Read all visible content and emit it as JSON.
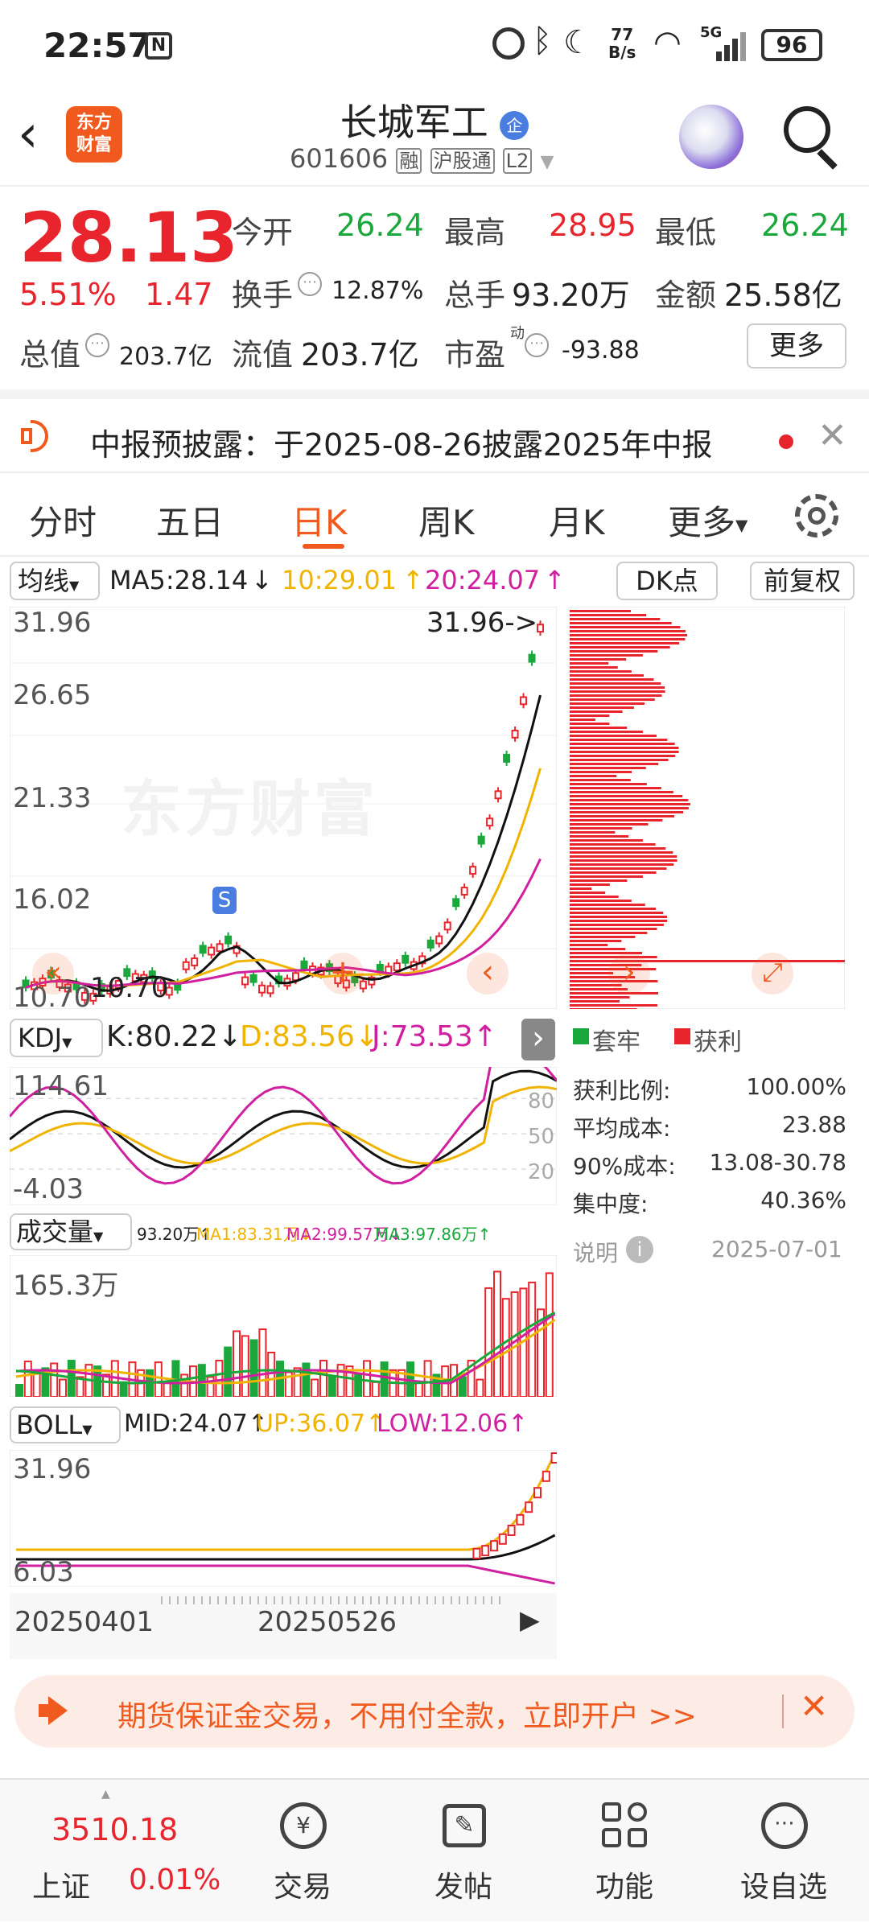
{
  "status": {
    "time": "22:57",
    "net_speed_top": "77",
    "net_speed_unit": "B/s",
    "signal": "5G",
    "battery": "96"
  },
  "header": {
    "logo_line1": "东方",
    "logo_line2": "财富",
    "title": "长城军工",
    "badge": "企",
    "code": "601606",
    "tags": [
      "融",
      "沪股通",
      "L2"
    ]
  },
  "quote": {
    "price": "28.13",
    "change_pct": "5.51%",
    "change": "1.47",
    "open_label": "今开",
    "open": "26.24",
    "high_label": "最高",
    "high": "28.95",
    "low_label": "最低",
    "low": "26.24",
    "turnover_label": "换手",
    "turnover": "12.87%",
    "volume_label": "总手",
    "volume": "93.20万",
    "amount_label": "金额",
    "amount": "25.58亿",
    "mktcap_label": "总值",
    "mktcap": "203.7亿",
    "float_label": "流值",
    "float_cap": "203.7亿",
    "pe_label": "市盈",
    "pe_sup": "动",
    "pe": "-93.88",
    "more_button": "更多"
  },
  "notice": {
    "text": "中报预披露：于2025-08-26披露2025年中报"
  },
  "tabs": {
    "items": [
      "分时",
      "五日",
      "日K",
      "周K",
      "月K",
      "更多"
    ],
    "active": 2
  },
  "kline": {
    "ma_select": "均线",
    "ma5": "MA5:28.14",
    "ma10": "10:29.01",
    "ma20": "20:24.07",
    "dk_button": "DK点",
    "fq_button": "前复权",
    "y_ticks": [
      "31.96",
      "26.65",
      "21.33",
      "16.02",
      "10.70"
    ],
    "max_annot": "31.96->",
    "min_annot": "10.70",
    "watermark": "东方财富",
    "s_marker": "S"
  },
  "chip": {
    "legend_trapped": "套牢",
    "legend_profit": "获利",
    "rows": [
      {
        "label": "获利比例:",
        "value": "100.00%"
      },
      {
        "label": "平均成本:",
        "value": "23.88"
      },
      {
        "label": "90%成本:",
        "value": "13.08-30.78"
      },
      {
        "label": "集中度:",
        "value": "40.36%"
      }
    ],
    "note_label": "说明",
    "date": "2025-07-01"
  },
  "kdj": {
    "select": "KDJ",
    "k": "K:80.22",
    "d": "D:83.56",
    "j": "J:73.53",
    "y_top": "114.61",
    "y_bottom": "-4.03",
    "levels": [
      "80",
      "50",
      "20"
    ]
  },
  "vol": {
    "select": "成交量",
    "v": "93.20万",
    "ma1": "MA1:83.31万",
    "ma2": "MA2:99.57万",
    "ma3": "MA3:97.86万",
    "y_top": "165.3万"
  },
  "boll": {
    "select": "BOLL",
    "mid": "MID:24.07",
    "up": "UP:36.07",
    "low": "LOW:12.06",
    "y_top": "31.96",
    "y_bottom": "6.03"
  },
  "xaxis": {
    "start": "20250401",
    "mid": "20250526"
  },
  "promo": {
    "text": "期货保证金交易，不用付全款，立即开户 >>"
  },
  "bottom": {
    "index_value": "3510.18",
    "index_name": "上证",
    "index_change": "0.01%",
    "items": [
      "交易",
      "发帖",
      "功能",
      "设自选"
    ]
  },
  "colors": {
    "up": "#e8252d",
    "down": "#1aa83c",
    "ma10": "#f0b400",
    "ma20": "#d020a0",
    "brand": "#f05a1e"
  }
}
